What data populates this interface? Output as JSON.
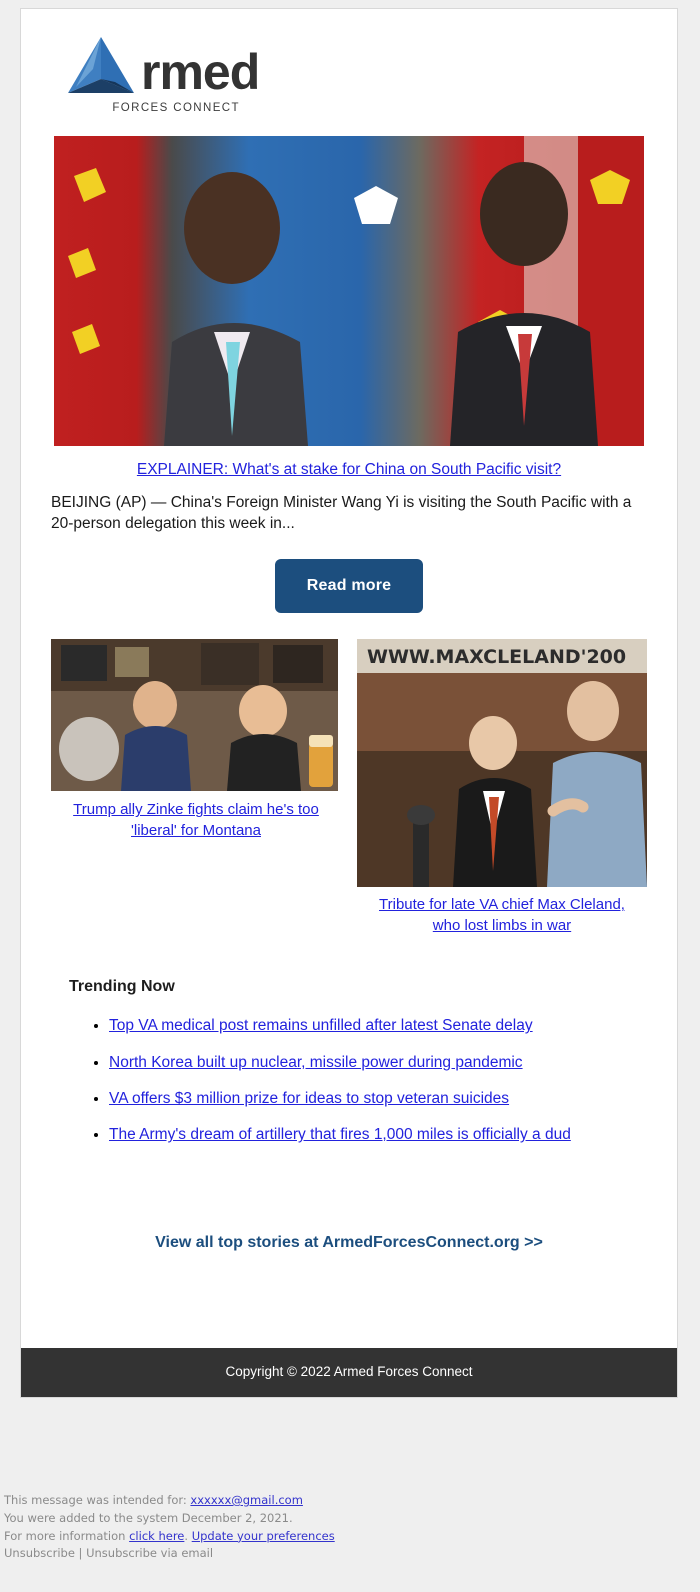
{
  "brand": {
    "logo_icon": "triangle-a-logo-icon",
    "word": "rmed",
    "tagline": "FORCES CONNECT",
    "mark_light": "#3f7fc1",
    "mark_dark": "#1c3f६6"
  },
  "hero": {
    "image_alt": "two diplomats speaking in front of flags",
    "headline": "EXPLAINER: What's at stake for China on South Pacific visit?",
    "summary": "BEIJING (AP) — China's Foreign Minister Wang Yi is visiting the South Pacific with a 20-person delegation this week in...",
    "button_label": "Read more"
  },
  "secondary_stories": [
    {
      "image_alt": "two men smiling in a bar",
      "headline_line1": "Trump ally Zinke fights claim he's too",
      "headline_line2": "'liberal' for Montana"
    },
    {
      "image_alt": "man at podium with another man gesturing, banner reads WWW.MAXCLELAND200",
      "headline_line1": "Tribute for late VA chief Max Cleland,",
      "headline_line2": "who lost limbs in war"
    }
  ],
  "trending": {
    "title": "Trending Now",
    "items": [
      "Top VA medical post remains unfilled after latest Senate delay",
      "North Korea built up nuclear, missile power during pandemic",
      "VA offers $3 million prize for ideas to stop veteran suicides",
      "The Army's dream of artillery that fires 1,000 miles is officially a dud"
    ]
  },
  "view_all": {
    "label": "View all top stories at ArmedForcesConnect.org >>"
  },
  "copyright": {
    "text": "Copyright © 2022 Armed Forces Connect"
  },
  "legal": {
    "line1_prefix": "This message was intended for: ",
    "recipient_email": "xxxxxx@gmail.com",
    "line2": "You were added to the system December 2, 2021.",
    "line3_prefix": "For more information ",
    "click_here": "click here",
    "line3_mid": ". ",
    "update_prefs": "Update your preferences",
    "unsubscribe": "Unsubscribe",
    "separator": " | ",
    "unsubscribe_email": "Unsubscribe via email"
  },
  "colors": {
    "link_blue": "#2222dd",
    "brand_navy": "#1c4e7e",
    "footer_dark": "#333333"
  }
}
